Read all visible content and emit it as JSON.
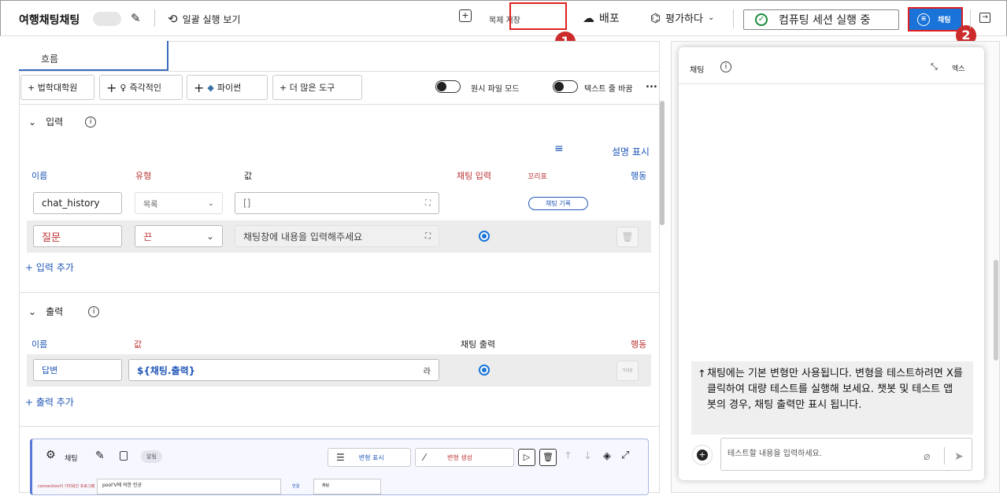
{
  "topbar": {
    "flow_title": "여행채팅채팅",
    "batch_run": "일괄 실행 보기",
    "clone_save": "복제 저장",
    "deploy": "배포",
    "evaluate": "평가하다",
    "compute_session": "컴퓨팅 세션 실행 중",
    "chat_button": "채팅"
  },
  "badges": {
    "one": "1",
    "two": "2"
  },
  "flow_tab": "흐름",
  "toolbar": {
    "law_school": "+ 법학대학원",
    "instant": "즉각적인",
    "python": "파이썬",
    "more_tools": "+ 더 많은 도구",
    "raw_file_mode": "원시 파일 모드",
    "text_wrap": "텍스트 줄 바꿈",
    "more": "..."
  },
  "inputs": {
    "section_title": "입력",
    "show_desc": "설명 표시",
    "columns": {
      "name": "이름",
      "type": "유형",
      "value": "값",
      "chat_input": "채팅 입력",
      "tail": "꼬리표",
      "action": "행동"
    },
    "rows": [
      {
        "name": "chat_history",
        "type": "목록",
        "value": "[]",
        "tag": "채팅 기록"
      },
      {
        "name": "질문",
        "type": "끈",
        "value": "채팅창에 내용을 입력해주세요"
      }
    ],
    "add": "+ 입력 추가"
  },
  "outputs": {
    "section_title": "출력",
    "columns": {
      "name": "이름",
      "value": "값",
      "chat_output": "채팅 출력",
      "action": "행동"
    },
    "rows": [
      {
        "name": "답변",
        "value": "${채팅.출력}",
        "suffix": "라",
        "action_small": "가리운"
      }
    ],
    "add": "+ 출력 추가"
  },
  "node": {
    "title": "채팅",
    "tag": "알림",
    "show_variants": "변형 표시",
    "generate_variants": "변형 생성",
    "sub_field": "pool'V에 의한 인공",
    "sub_left": "connection이 가리워진 프로그램",
    "sub_label": "연결",
    "sub_select": "채팅"
  },
  "chat": {
    "title": "채팅",
    "expand": "엑스",
    "notice": "채팅에는 기본 변형만 사용됩니다. 변형을 테스트하려면 X를 클릭하여 대량 테스트를 실행해 보세요. 챗봇 및 테스트 앱 봇의 경우, 채팅 출력만 표시 됩니다.",
    "placeholder": "테스트할 내용을 입력하세요."
  },
  "colors": {
    "accent": "#1a73d9",
    "highlight": "#e02020",
    "badge": "#cc2b2b",
    "type_red": "#b33"
  }
}
